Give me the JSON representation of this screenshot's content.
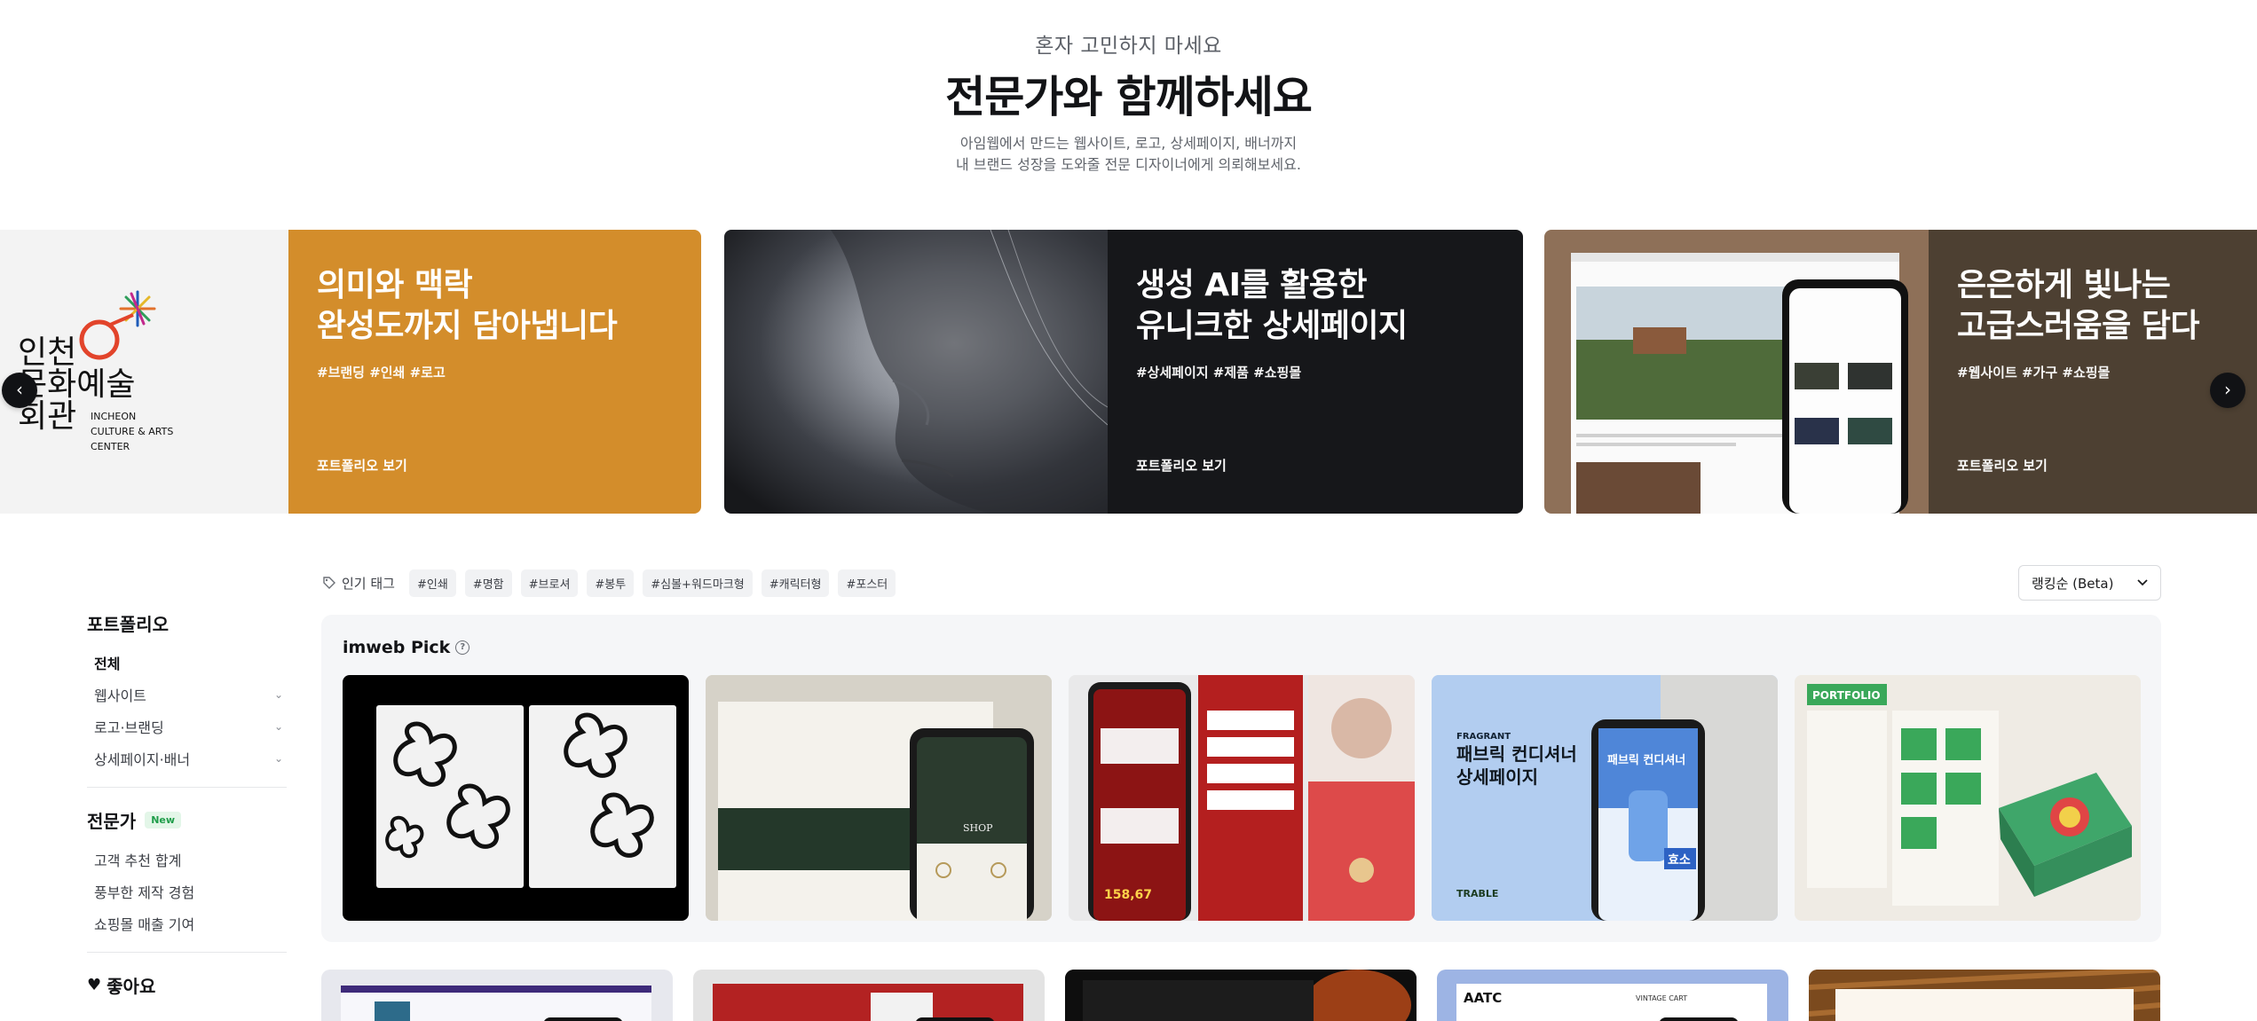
{
  "hero": {
    "eyebrow": "혼자 고민하지 마세요",
    "title": "전문가와 함께하세요",
    "desc_line1": "아임웹에서 만드는 웹사이트, 로고, 상세페이지, 배너까지",
    "desc_line2": "내 브랜드 성장을 도와줄 전문 디자이너에게 의뢰해보세요."
  },
  "carousel": {
    "prev_icon": "chevron-left-icon",
    "next_icon": "chevron-right-icon",
    "slides": [
      {
        "logo_text_ko_1": "인천",
        "logo_text_ko_2": "문화예술",
        "logo_text_ko_3": "회관",
        "logo_text_en_1": "INCHEON",
        "logo_text_en_2": "CULTURE & ARTS",
        "logo_text_en_3": "CENTER",
        "headline_1": "의미와 맥락",
        "headline_2": "완성도까지 담아냅니다",
        "tags": "#브랜딩 #인쇄 #로고",
        "cta": "포트폴리오 보기",
        "color": "#d38d2b"
      },
      {
        "headline_1": "생성 AI를 활용한",
        "headline_2": "유니크한 상세페이지",
        "tags": "#상세페이지 #제품 #쇼핑몰",
        "cta": "포트폴리오 보기",
        "color": "#16171a"
      },
      {
        "headline_1": "은은하게 빛나는",
        "headline_2": "고급스러움을 담다",
        "tags": "#웹사이트 #가구 #쇼핑몰",
        "cta": "포트폴리오 보기",
        "color": "#4d4032"
      }
    ]
  },
  "sidebar": {
    "portfolio_heading": "포트폴리오",
    "portfolio_items": [
      {
        "label": "전체",
        "active": true
      },
      {
        "label": "웹사이트"
      },
      {
        "label": "로고·브랜딩"
      },
      {
        "label": "상세페이지·배너"
      }
    ],
    "expert_heading": "전문가",
    "new_badge": "New",
    "expert_items": [
      {
        "label": "고객 추천 합계"
      },
      {
        "label": "풍부한 제작 경험"
      },
      {
        "label": "쇼핑몰 매출 기여"
      }
    ],
    "like_heading": "좋아요",
    "like_icon": "heart-icon"
  },
  "tagbar": {
    "label": "인기 태그",
    "tag_icon": "tag-icon",
    "chips": [
      "#인쇄",
      "#명함",
      "#브로셔",
      "#봉투",
      "#심볼+워드마크형",
      "#캐릭터형",
      "#포스터"
    ]
  },
  "sort": {
    "selected": "랭킹순 (Beta)",
    "icon": "chevron-down-icon"
  },
  "pick": {
    "title": "imweb Pick",
    "help_icon": "question-circle-icon",
    "card4_brand": "FRAGRANT",
    "card4_title_1": "패브릭 컨디셔너",
    "card4_title_2": "상세페이지",
    "card4_phone_title": "패브릭 컨디셔너",
    "card4_badge": "효소",
    "card4_footer": "TRABLE",
    "card5_label": "PORTFOLIO",
    "card3_price": "158,67",
    "card2_shop": "SHOP"
  },
  "bottom_cards": {
    "card4_label": "AATC",
    "card4_links": "VINTAGE CART"
  },
  "colors": {
    "accent_orange": "#d38d2b",
    "dark_slide": "#16171a",
    "brown_slide": "#4d4032",
    "new_badge_green": "#1f9d4a"
  }
}
